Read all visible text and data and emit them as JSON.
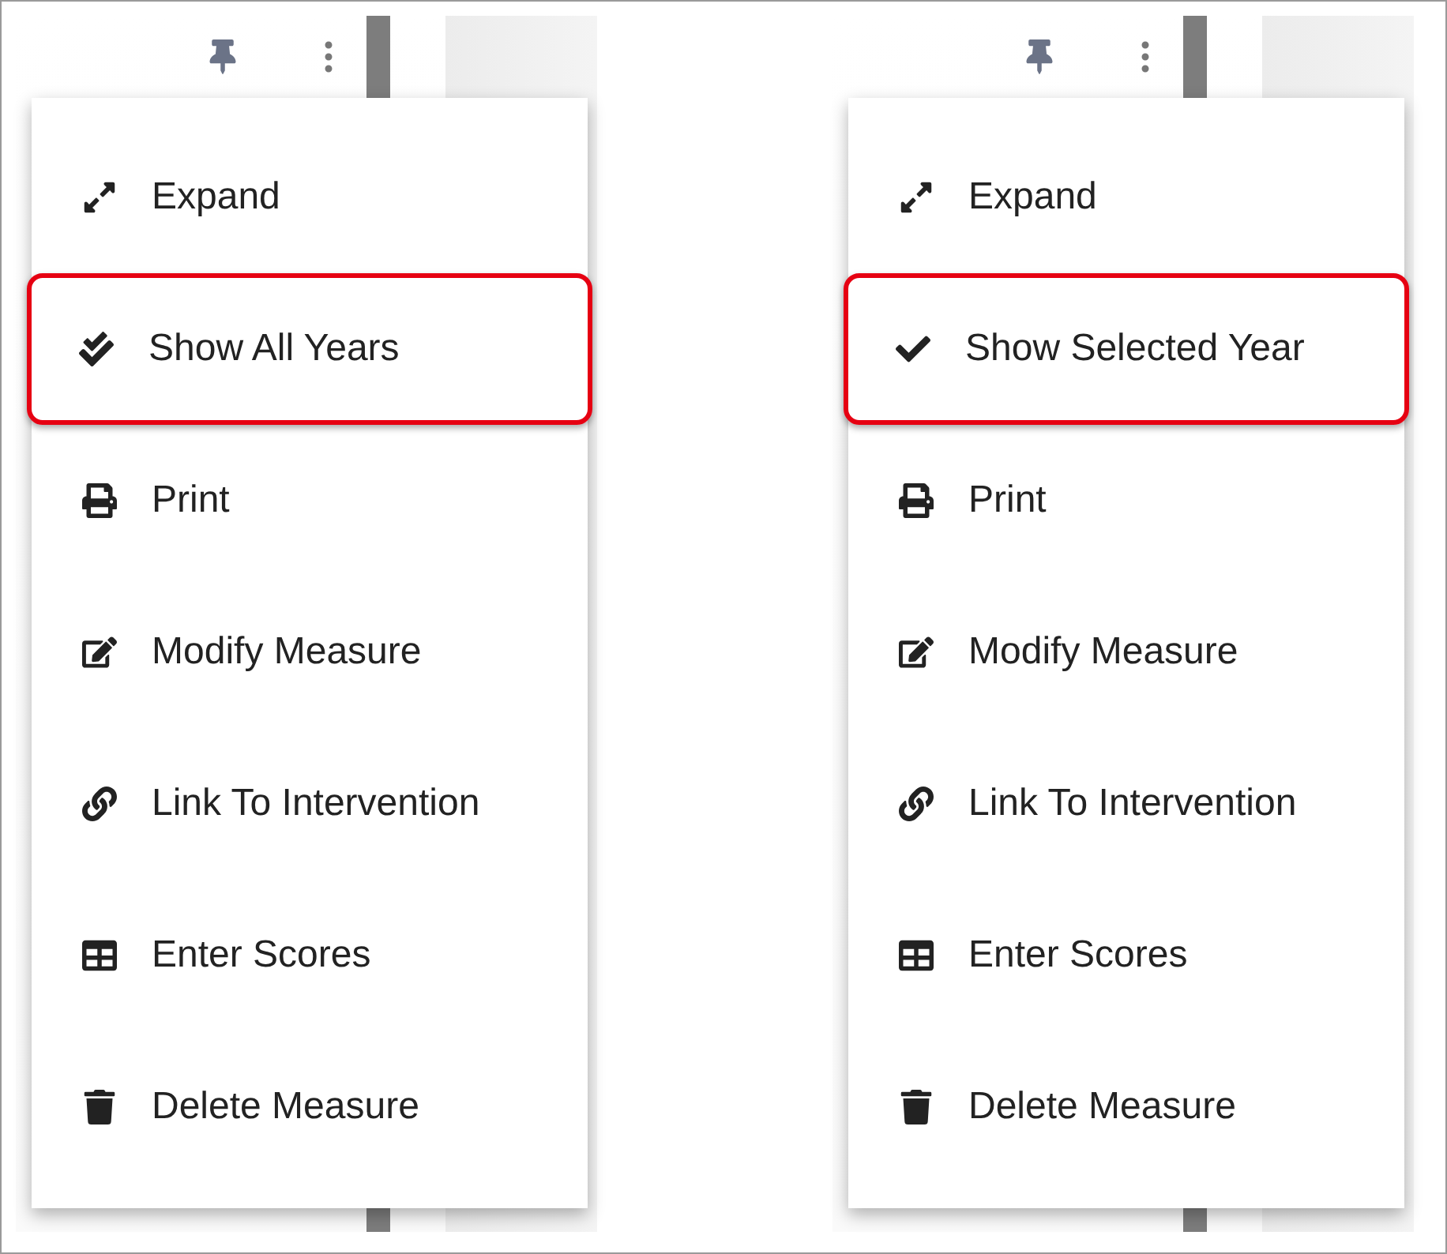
{
  "panels": [
    {
      "items": [
        {
          "label": "Expand",
          "kind": "expand",
          "highlighted": false
        },
        {
          "label": "Show All Years",
          "kind": "check-double",
          "highlighted": true
        },
        {
          "label": "Print",
          "kind": "print",
          "highlighted": false
        },
        {
          "label": "Modify Measure",
          "kind": "edit",
          "highlighted": false
        },
        {
          "label": "Link To Intervention",
          "kind": "link",
          "highlighted": false
        },
        {
          "label": "Enter Scores",
          "kind": "table",
          "highlighted": false
        },
        {
          "label": "Delete Measure",
          "kind": "trash",
          "highlighted": false
        }
      ]
    },
    {
      "items": [
        {
          "label": "Expand",
          "kind": "expand",
          "highlighted": false
        },
        {
          "label": "Show Selected Year",
          "kind": "check",
          "highlighted": true
        },
        {
          "label": "Print",
          "kind": "print",
          "highlighted": false
        },
        {
          "label": "Modify Measure",
          "kind": "edit",
          "highlighted": false
        },
        {
          "label": "Link To Intervention",
          "kind": "link",
          "highlighted": false
        },
        {
          "label": "Enter Scores",
          "kind": "table",
          "highlighted": false
        },
        {
          "label": "Delete Measure",
          "kind": "trash",
          "highlighted": false
        }
      ]
    }
  ]
}
